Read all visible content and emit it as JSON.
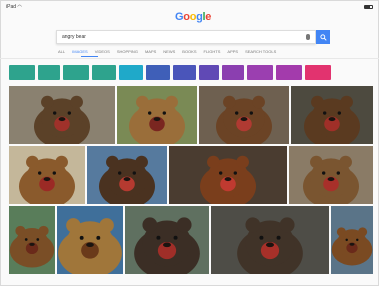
{
  "search": {
    "query": "angry bear"
  },
  "tabs": [
    {
      "label": "ALL",
      "active": false
    },
    {
      "label": "IMAGES",
      "active": true
    },
    {
      "label": "VIDEOS",
      "active": false
    },
    {
      "label": "SHOPPING",
      "active": false
    },
    {
      "label": "MAPS",
      "active": false
    },
    {
      "label": "NEWS",
      "active": false
    },
    {
      "label": "BOOKS",
      "active": false
    },
    {
      "label": "FLIGHTS",
      "active": false
    },
    {
      "label": "APPS",
      "active": false
    },
    {
      "label": "SEARCH TOOLS",
      "active": false
    }
  ],
  "chips": [
    {
      "color": "#2ea38d"
    },
    {
      "color": "#2ea38d"
    },
    {
      "color": "#2ea38d"
    },
    {
      "color": "#2ea38d"
    },
    {
      "color": "#1fa9c9"
    },
    {
      "color": "#3f5fb8"
    },
    {
      "color": "#4a55ba"
    },
    {
      "color": "#6049b5"
    },
    {
      "color": "#8b3fb0"
    },
    {
      "color": "#9b3fb0"
    },
    {
      "color": "#a33bac"
    },
    {
      "color": "#e2336f"
    }
  ],
  "images": [
    {
      "name": "bear-image-1",
      "bg": "#8a8170",
      "fur": "#5b4128",
      "mouth": "#a0312a"
    },
    {
      "name": "bear-image-2",
      "bg": "#7a8a55",
      "fur": "#9a6e3a",
      "mouth": "#7a2620"
    },
    {
      "name": "bear-image-3",
      "bg": "#6e6050",
      "fur": "#6b4325",
      "mouth": "#b03a32"
    },
    {
      "name": "bear-image-4",
      "bg": "#4d4a3f",
      "fur": "#5a3a20",
      "mouth": "#a02f28"
    },
    {
      "name": "bear-image-5",
      "bg": "#c4b79a",
      "fur": "#8a5a2c",
      "mouth": "#9b2a25"
    },
    {
      "name": "bear-image-6",
      "bg": "#567a9e",
      "fur": "#4a3220",
      "mouth": "#b53a30"
    },
    {
      "name": "bear-image-7",
      "bg": "#4a3c30",
      "fur": "#7a3e1c",
      "mouth": "#c03a30"
    },
    {
      "name": "bear-image-8",
      "bg": "#8a7b66",
      "fur": "#7a5530",
      "mouth": "#a8302a"
    },
    {
      "name": "bear-image-9",
      "bg": "#597d5a",
      "fur": "#7a4e26",
      "mouth": "#6a2a1a"
    },
    {
      "name": "bear-image-10",
      "bg": "#3f6f9a",
      "fur": "#a0763a",
      "mouth": "#6a3a1a"
    },
    {
      "name": "bear-image-11",
      "bg": "#5f7060",
      "fur": "#3b2e25",
      "mouth": "#a02e28"
    },
    {
      "name": "bear-image-12",
      "bg": "#4e4d47",
      "fur": "#403328",
      "mouth": "#a83029"
    },
    {
      "name": "bear-image-13",
      "bg": "#5a7488",
      "fur": "#7a4a22",
      "mouth": "#6a2a1a"
    }
  ]
}
